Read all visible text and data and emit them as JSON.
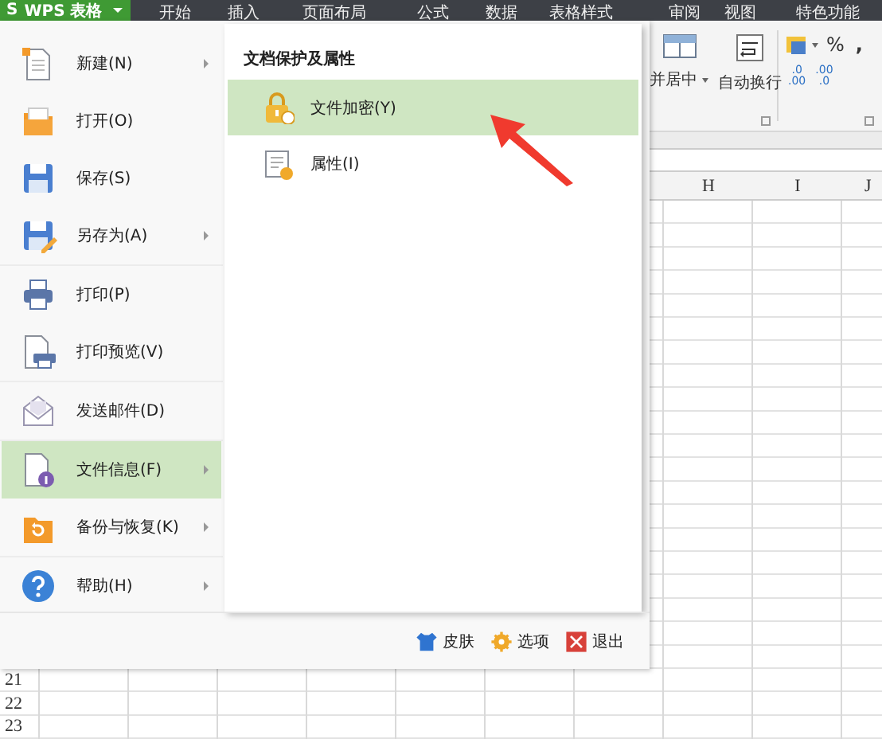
{
  "app_button": {
    "logo": "S",
    "label": "WPS 表格"
  },
  "ribbon_tabs": [
    {
      "label": "开始"
    },
    {
      "label": "插入"
    },
    {
      "label": "页面布局"
    },
    {
      "label": "公式"
    },
    {
      "label": "数据"
    },
    {
      "label": "表格样式"
    },
    {
      "label": "审阅"
    },
    {
      "label": "视图"
    },
    {
      "label": "特色功能"
    }
  ],
  "ribbon": {
    "merge_label": "并居中",
    "wrap_label": "自动换行",
    "percent": "%",
    "comma": ",",
    "decimal_buttons": [
      {
        "top": ".0",
        "bottom": ".00"
      },
      {
        "top": ".00",
        "bottom": ".0"
      }
    ]
  },
  "sheet": {
    "columns": [
      "H",
      "I",
      "J"
    ],
    "row_numbers": [
      "21",
      "22",
      "23"
    ]
  },
  "file_menu": {
    "items": [
      {
        "label": "新建(N)",
        "has_submenu": true,
        "selected": false
      },
      {
        "label": "打开(O)",
        "has_submenu": false,
        "selected": false
      },
      {
        "label": "保存(S)",
        "has_submenu": false,
        "selected": false
      },
      {
        "label": "另存为(A)",
        "has_submenu": true,
        "selected": false
      },
      {
        "label": "打印(P)",
        "has_submenu": false,
        "selected": false
      },
      {
        "label": "打印预览(V)",
        "has_submenu": false,
        "selected": false
      },
      {
        "label": "发送邮件(D)",
        "has_submenu": false,
        "selected": false
      },
      {
        "label": "文件信息(F)",
        "has_submenu": true,
        "selected": true
      },
      {
        "label": "备份与恢复(K)",
        "has_submenu": true,
        "selected": false
      },
      {
        "label": "帮助(H)",
        "has_submenu": true,
        "selected": false
      }
    ],
    "submenu": {
      "title": "文档保护及属性",
      "items": [
        {
          "label": "文件加密(Y)",
          "selected": true
        },
        {
          "label": "属性(I)",
          "selected": false
        }
      ]
    },
    "footer_buttons": [
      {
        "label": "皮肤"
      },
      {
        "label": "选项"
      },
      {
        "label": "退出"
      }
    ]
  }
}
